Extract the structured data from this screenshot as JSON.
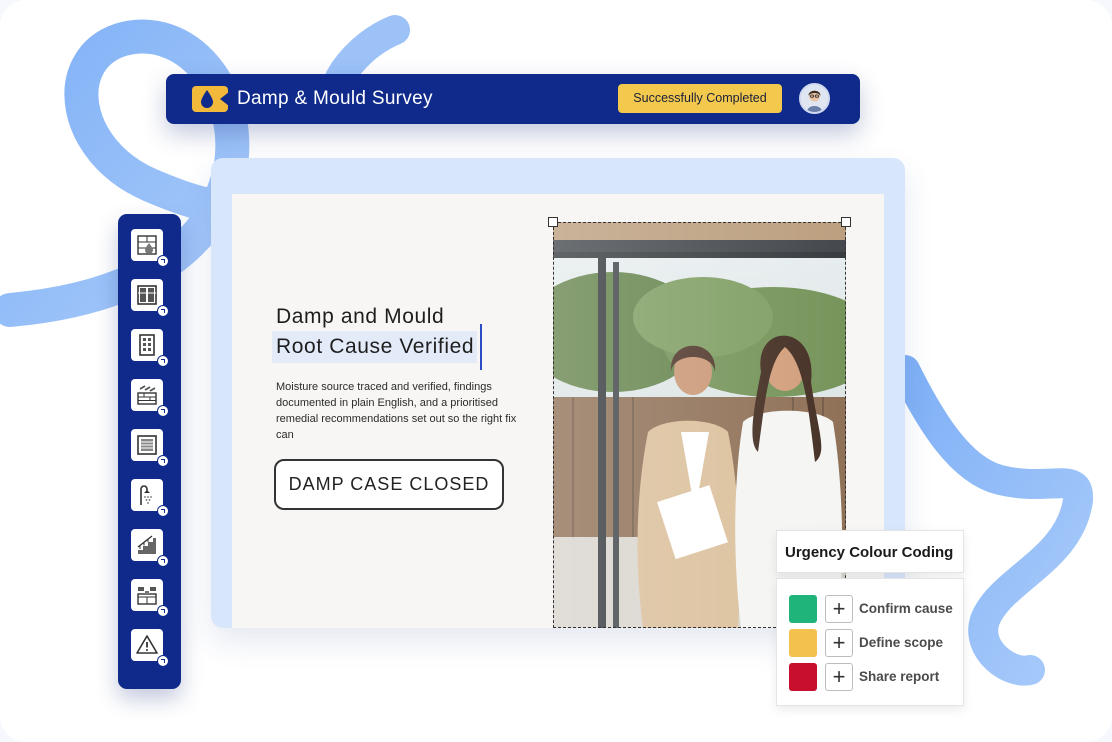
{
  "header": {
    "title": "Damp & Mould Survey",
    "status_badge": "Successfully Completed",
    "app_icon": "water-drop-camera-icon",
    "avatar_icon": "user-avatar-icon"
  },
  "main": {
    "headline_line1": "Damp and Mould",
    "headline_line2": "Root Cause Verified",
    "body": "Moisture source traced and verified, findings documented in plain English, and a prioritised remedial recommendations set out so the right fix can",
    "cta_label": "DAMP CASE CLOSED",
    "photo_icon": "two-women-window-photo"
  },
  "toolbar": {
    "items": [
      {
        "icon": "damp-wall-icon"
      },
      {
        "icon": "window-icon"
      },
      {
        "icon": "door-icon"
      },
      {
        "icon": "brick-vent-icon"
      },
      {
        "icon": "radiator-icon"
      },
      {
        "icon": "shower-icon"
      },
      {
        "icon": "stairs-icon"
      },
      {
        "icon": "kitchen-icon"
      },
      {
        "icon": "warning-icon"
      }
    ]
  },
  "urgency": {
    "title": "Urgency Colour Coding",
    "items": [
      {
        "label": "Confirm cause",
        "color": "#1fb57a"
      },
      {
        "label": "Define scope",
        "color": "#f2c14e"
      },
      {
        "label": "Share report",
        "color": "#c8102e"
      }
    ]
  },
  "colors": {
    "brand_navy": "#0f2a8a",
    "badge_yellow": "#f2c94c",
    "swirl_blue": "#8fb8f5"
  }
}
